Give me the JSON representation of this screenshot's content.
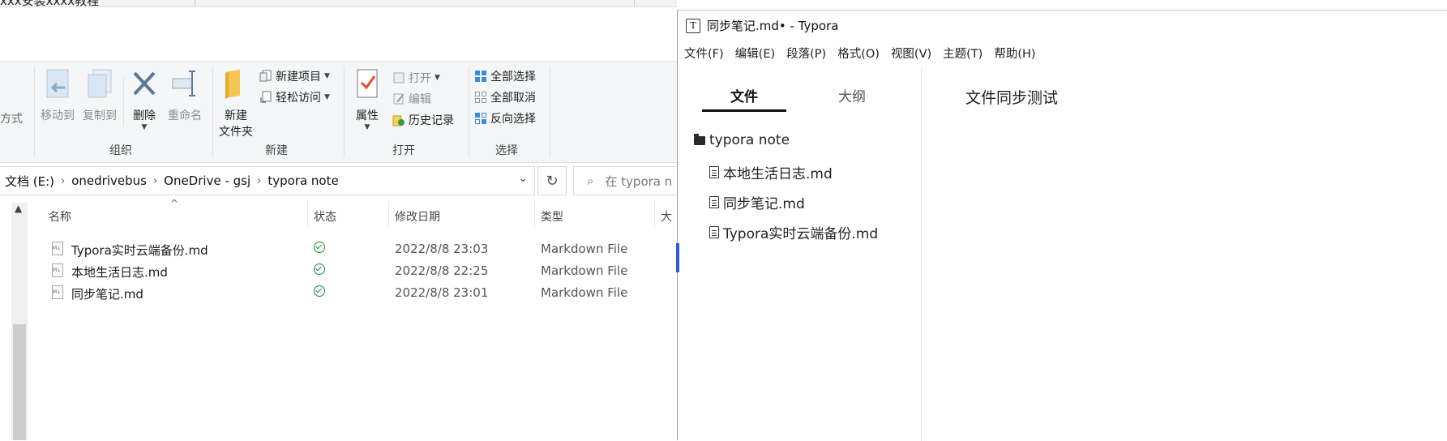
{
  "explorer": {
    "top_cut_text": "xxx安装xxxx教程",
    "ribbon": {
      "partial_label": "方式",
      "buttons": {
        "move_to": "移动到",
        "copy_to": "复制到",
        "delete": "删除",
        "rename": "重命名",
        "new_folder_line1": "新建",
        "new_folder_line2": "文件夹",
        "new_item": "新建项目",
        "easy_access": "轻松访问",
        "properties": "属性",
        "open": "打开",
        "edit": "编辑",
        "history": "历史记录",
        "select_all": "全部选择",
        "select_none": "全部取消",
        "invert_selection": "反向选择"
      },
      "groups": {
        "organize": "组织",
        "new": "新建",
        "open": "打开",
        "select": "选择"
      }
    },
    "address": {
      "crumbs": [
        "文档 (E:)",
        "onedrivebus",
        "OneDrive - gsj",
        "typora note"
      ]
    },
    "search": {
      "placeholder": "在 typora n"
    },
    "columns": {
      "name": "名称",
      "status": "状态",
      "modified": "修改日期",
      "type": "类型",
      "size": "大"
    },
    "files": [
      {
        "name": "Typora实时云端备份.md",
        "date": "2022/8/8 23:03",
        "type": "Markdown File"
      },
      {
        "name": "本地生活日志.md",
        "date": "2022/8/8 22:25",
        "type": "Markdown File"
      },
      {
        "name": "同步笔记.md",
        "date": "2022/8/8 23:01",
        "type": "Markdown File"
      }
    ]
  },
  "typora": {
    "title": "同步笔记.md• - Typora",
    "logo": "T",
    "menu": [
      "文件(F)",
      "编辑(E)",
      "段落(P)",
      "格式(O)",
      "视图(V)",
      "主题(T)",
      "帮助(H)"
    ],
    "sidebar": {
      "tab_files": "文件",
      "tab_outline": "大纲",
      "folder": "typora note",
      "files": [
        "本地生活日志.md",
        "同步笔记.md",
        "Typora实时云端备份.md"
      ]
    },
    "document": {
      "text": "文件同步测试"
    }
  }
}
